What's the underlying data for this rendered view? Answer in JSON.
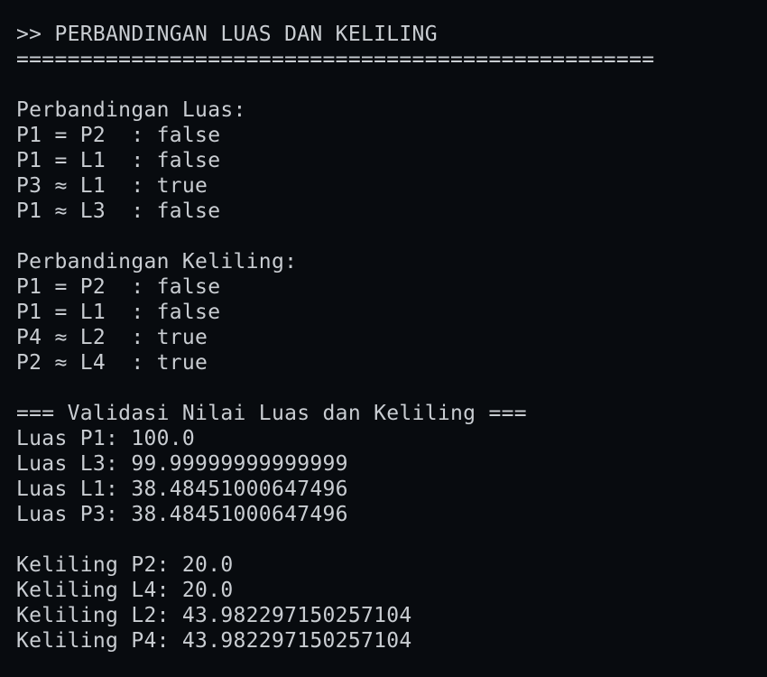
{
  "terminal": {
    "header": ">> PERBANDINGAN LUAS DAN KELILING",
    "separator": "==================================================",
    "luas_section": {
      "title": "Perbandingan Luas:",
      "lines": [
        "P1 = P2  : false",
        "P1 = L1  : false",
        "P3 ≈ L1  : true",
        "P1 ≈ L3  : false"
      ]
    },
    "keliling_section": {
      "title": "Perbandingan Keliling:",
      "lines": [
        "P1 = P2  : false",
        "P1 = L1  : false",
        "P4 ≈ L2  : true",
        "P2 ≈ L4  : true"
      ]
    },
    "validasi": {
      "title": "=== Validasi Nilai Luas dan Keliling ===",
      "luas_lines": [
        "Luas P1: 100.0",
        "Luas L3: 99.99999999999999",
        "Luas L1: 38.48451000647496",
        "Luas P3: 38.48451000647496"
      ],
      "keliling_lines": [
        "Keliling P2: 20.0",
        "Keliling L4: 20.0",
        "Keliling L2: 43.982297150257104",
        "Keliling P4: 43.982297150257104"
      ]
    }
  }
}
